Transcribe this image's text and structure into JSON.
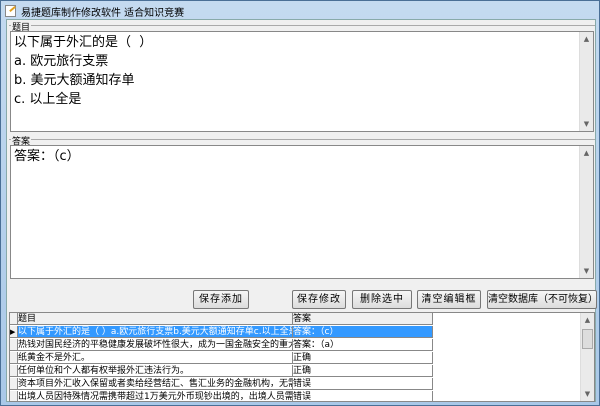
{
  "window": {
    "title": "易捷题库制作修改软件  适合知识竞赛"
  },
  "question": {
    "label": "题目",
    "text": "以下属于外汇的是（  ）\na. 欧元旅行支票\nb. 美元大额通知存单\nc. 以上全是"
  },
  "answer": {
    "label": "答案",
    "text": "答案：（c）"
  },
  "buttons": {
    "save_add": "保存添加",
    "save_edit": "保存修改",
    "delete": "删除选中",
    "clear_edit": "清空编辑框",
    "clear_db": "清空数据库（不可恢复）"
  },
  "table": {
    "headers": [
      "题目",
      "答案"
    ],
    "rows": [
      [
        "以下属于外汇的是（ ）a.欧元旅行支票b.美元大额通知存单c.以上全是",
        "答案：（c）"
      ],
      [
        "热钱对国民经济的平稳健康发展破坏性很大，成为一国金融安全的重大隐患",
        "答案：（a）"
      ],
      [
        "纸黄金不是外汇。",
        "正确"
      ],
      [
        "任何单位和个人都有权举报外汇违法行为。",
        "正确"
      ],
      [
        "资本项目外汇收入保留或者卖给经营结汇、售汇业务的金融机构，无需经外汇",
        "错误"
      ],
      [
        "出境人员因特殊情况需携带超过1万美元外币现钞出境的，出境人员需向银行",
        "错误"
      ]
    ]
  }
}
